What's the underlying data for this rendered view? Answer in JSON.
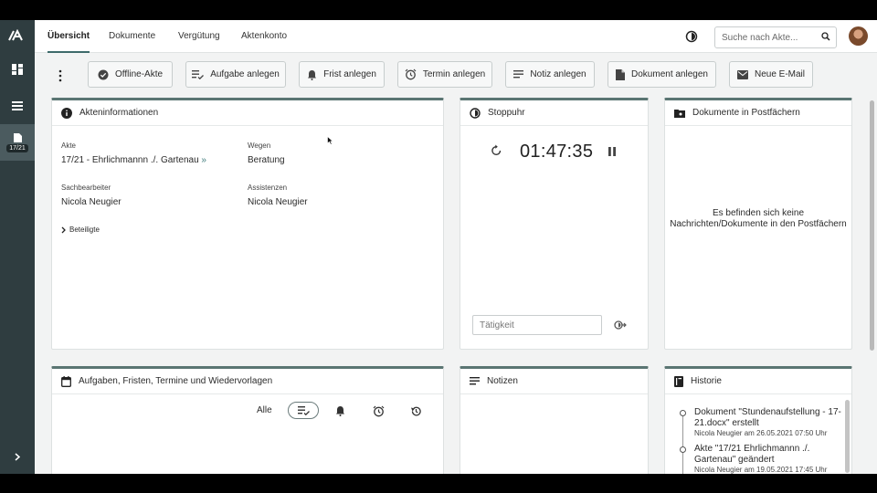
{
  "sidebar": {
    "badge": "17/21"
  },
  "tabs": [
    "Übersicht",
    "Dokumente",
    "Vergütung",
    "Aktenkonto"
  ],
  "search": {
    "placeholder": "Suche nach Akte..."
  },
  "toolbar": [
    "Offline-Akte",
    "Aufgabe anlegen",
    "Frist anlegen",
    "Termin anlegen",
    "Notiz anlegen",
    "Dokument anlegen",
    "Neue E-Mail"
  ],
  "akteninfo": {
    "title": "Akteninformationen",
    "akte_label": "Akte",
    "akte_value": "17/21 - Ehrlichmannn ./. Gartenau",
    "wegen_label": "Wegen",
    "wegen_value": "Beratung",
    "sach_label": "Sachbearbeiter",
    "sach_value": "Nicola Neugier",
    "assist_label": "Assistenzen",
    "assist_value": "Nicola Neugier",
    "beteiligte": "Beteiligte"
  },
  "stoppuhr": {
    "title": "Stoppuhr",
    "time": "01:47:35",
    "placeholder": "Tätigkeit"
  },
  "postfaecher": {
    "title": "Dokumente in Postfächern",
    "empty_line1": "Es befinden sich keine",
    "empty_line2": "Nachrichten/Dokumente in den Postfächern"
  },
  "aufgaben": {
    "title": "Aufgaben, Fristen, Termine und Wiedervorlagen",
    "filter_all": "Alle"
  },
  "notizen": {
    "title": "Notizen"
  },
  "historie": {
    "title": "Historie",
    "items": [
      {
        "title": "Dokument \"Stundenaufstellung - 17-21.docx\" erstellt",
        "meta": "Nicola Neugier am 26.05.2021 07:50 Uhr"
      },
      {
        "title": "Akte \"17/21 Ehrlichmannn ./. Gartenau\" geändert",
        "meta": "Nicola Neugier am 19.05.2021 17:45 Uhr"
      }
    ]
  }
}
